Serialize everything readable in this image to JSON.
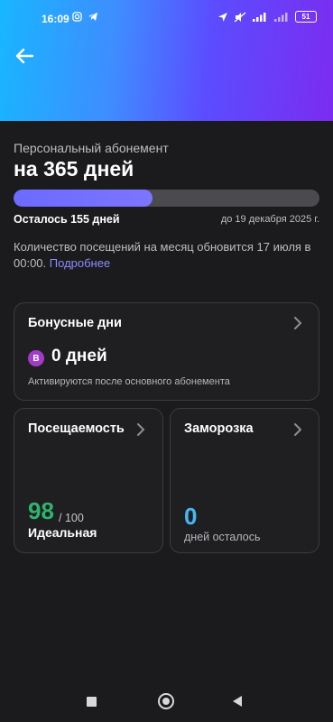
{
  "status_bar": {
    "time": "16:09",
    "battery": "51",
    "icons": [
      "instagram-icon",
      "telegram-icon",
      "location-icon",
      "mute-icon",
      "signal-icon",
      "wifi-icon"
    ]
  },
  "header": {
    "back_icon": "arrow-left-icon",
    "gradient_colors": [
      "#18b6ff",
      "#5b4dff",
      "#7b2cf0"
    ]
  },
  "subscription": {
    "caption": "Персональный абонемент",
    "title": "на 365 дней",
    "progress_fraction": 0.455,
    "remaining": "Осталось 155 дней",
    "until": "до 19 декабря 2025 г.",
    "notice": "Количество посещений на месяц обновится 17 июля в 00:00.",
    "more_link": "Подробнее"
  },
  "bonus_card": {
    "title": "Бонусные дни",
    "badge": "B",
    "value": "0 дней",
    "subtitle": "Активируются после основного абонемента"
  },
  "attendance_card": {
    "title": "Посещаемость",
    "score": "98",
    "max": "/ 100",
    "label": "Идеальная",
    "accent": "#2fb36c"
  },
  "freeze_card": {
    "title": "Заморозка",
    "value": "0",
    "subtitle": "дней осталось",
    "accent": "#45b7f4"
  },
  "navbar": {
    "icons": [
      "recent-apps-icon",
      "home-icon",
      "back-icon"
    ]
  }
}
